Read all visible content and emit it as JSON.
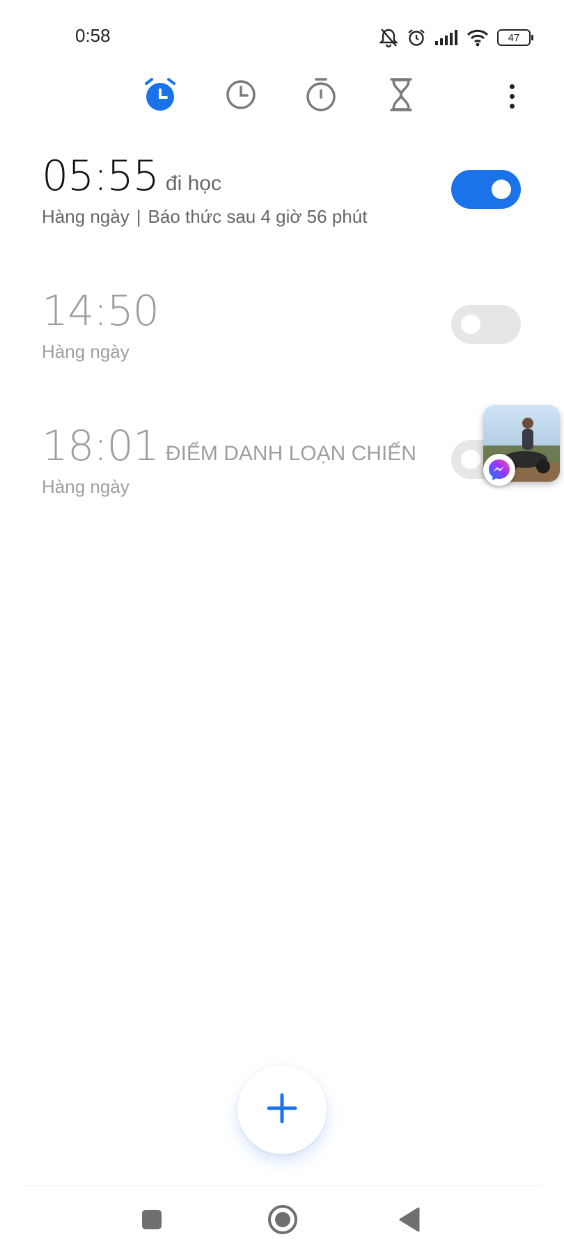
{
  "status_bar": {
    "time": "0:58",
    "battery": "47",
    "icons": [
      "bell-off-icon",
      "alarm-icon",
      "signal-icon",
      "wifi-icon",
      "battery-icon"
    ]
  },
  "tabs": [
    {
      "name": "alarm",
      "icon": "alarm-icon",
      "active": true
    },
    {
      "name": "world-clock",
      "icon": "clock-icon",
      "active": false
    },
    {
      "name": "stopwatch",
      "icon": "stopwatch-icon",
      "active": false
    },
    {
      "name": "timer",
      "icon": "hourglass-icon",
      "active": false
    }
  ],
  "alarms": [
    {
      "time": "05:55",
      "label": "đi học",
      "repeat": "Hàng ngày",
      "separator": "|",
      "remaining": "Báo thức sau 4 giờ 56 phút",
      "enabled": true
    },
    {
      "time": "14:50",
      "label": "",
      "repeat": "Hàng ngày",
      "enabled": false
    },
    {
      "time": "18:01",
      "label": "ĐIỂM DANH LOẠN CHIẾN",
      "repeat": "Hàng ngày",
      "enabled": false
    }
  ],
  "colors": {
    "accent": "#1a73e8",
    "toggle_off": "#e6e6e6",
    "inactive_text": "#9e9e9e"
  },
  "fab_icon": "plus-icon",
  "nav_bar": [
    "recents-square-icon",
    "home-circle-icon",
    "back-triangle-icon"
  ]
}
